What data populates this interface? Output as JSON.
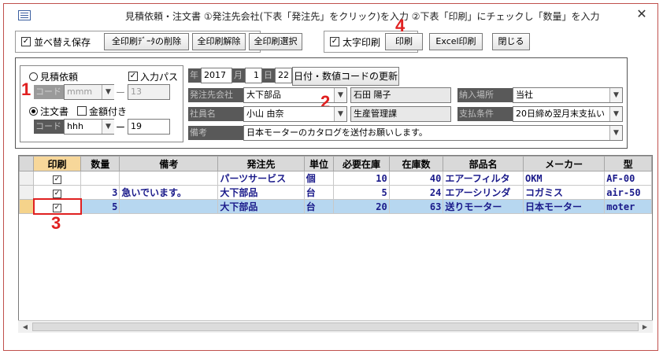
{
  "window": {
    "title": "見積依頼・注文書 ①発注先会社(下表「発注先」をクリック)を入力 ②下表「印刷」にチェックし「数量」を入力",
    "close": "✕"
  },
  "toolbar": {
    "sort_save_label": "並べ替え保存",
    "delete_print_data": "全印刷ﾃﾞｰﾀの削除",
    "clear_all_print": "全印刷解除",
    "select_all_print": "全印刷選択",
    "bold_print_label": "太字印刷",
    "print": "印刷",
    "excel_print": "Excel印刷",
    "close": "閉じる"
  },
  "annotations": {
    "n1": "1",
    "n2": "2",
    "n3": "3",
    "n4": "4"
  },
  "left_panel": {
    "estimate_request": "見積依頼",
    "input_pass": "入力パス",
    "code1_label": "コード",
    "code1_value": "mmm",
    "code1_dash": "ー",
    "code1_num": "13",
    "order_form": "注文書",
    "with_amount": "金額付き",
    "code2_label": "コード",
    "code2_value": "hhh",
    "code2_dash": "ー",
    "code2_num": "19"
  },
  "header_form": {
    "year_label": "年",
    "year": "2017",
    "month_label": "月",
    "month": "1",
    "day_label": "日",
    "day": "22",
    "update_button": "日付・数値コードの更新",
    "supplier_label": "発注先会社",
    "supplier_value": "大下部品",
    "contact_value": "石田 陽子",
    "delivery_label": "納入場所",
    "delivery_value": "当社",
    "employee_label": "社員名",
    "employee_value": "小山 由奈",
    "department_value": "生産管理課",
    "payment_label": "支払条件",
    "payment_value": "20日締め翌月末支払い",
    "remarks_label": "備考",
    "remarks_value": "日本モーターのカタログを送付お願いします。"
  },
  "grid": {
    "columns": [
      "印刷",
      "数量",
      "備考",
      "発注先",
      "単位",
      "必要在庫",
      "在庫数",
      "部品名",
      "メーカー",
      "型"
    ],
    "rows": [
      {
        "print": "✓",
        "qty": "",
        "note": "",
        "supplier": "パーツサービス",
        "unit": "個",
        "required": "10",
        "stock": "40",
        "part": "エアーフィルタ",
        "maker": "OKM",
        "model": "AF-00"
      },
      {
        "print": "✓",
        "qty": "3",
        "note": "急いでいます。",
        "supplier": "大下部品",
        "unit": "台",
        "required": "5",
        "stock": "24",
        "part": "エアーシリンダ",
        "maker": "コガミス",
        "model": "air-50"
      },
      {
        "print": "✓",
        "qty": "5",
        "note": "",
        "supplier": "大下部品",
        "unit": "台",
        "required": "20",
        "stock": "63",
        "part": "送りモーター",
        "maker": "日本モーター",
        "model": "moter"
      }
    ]
  }
}
